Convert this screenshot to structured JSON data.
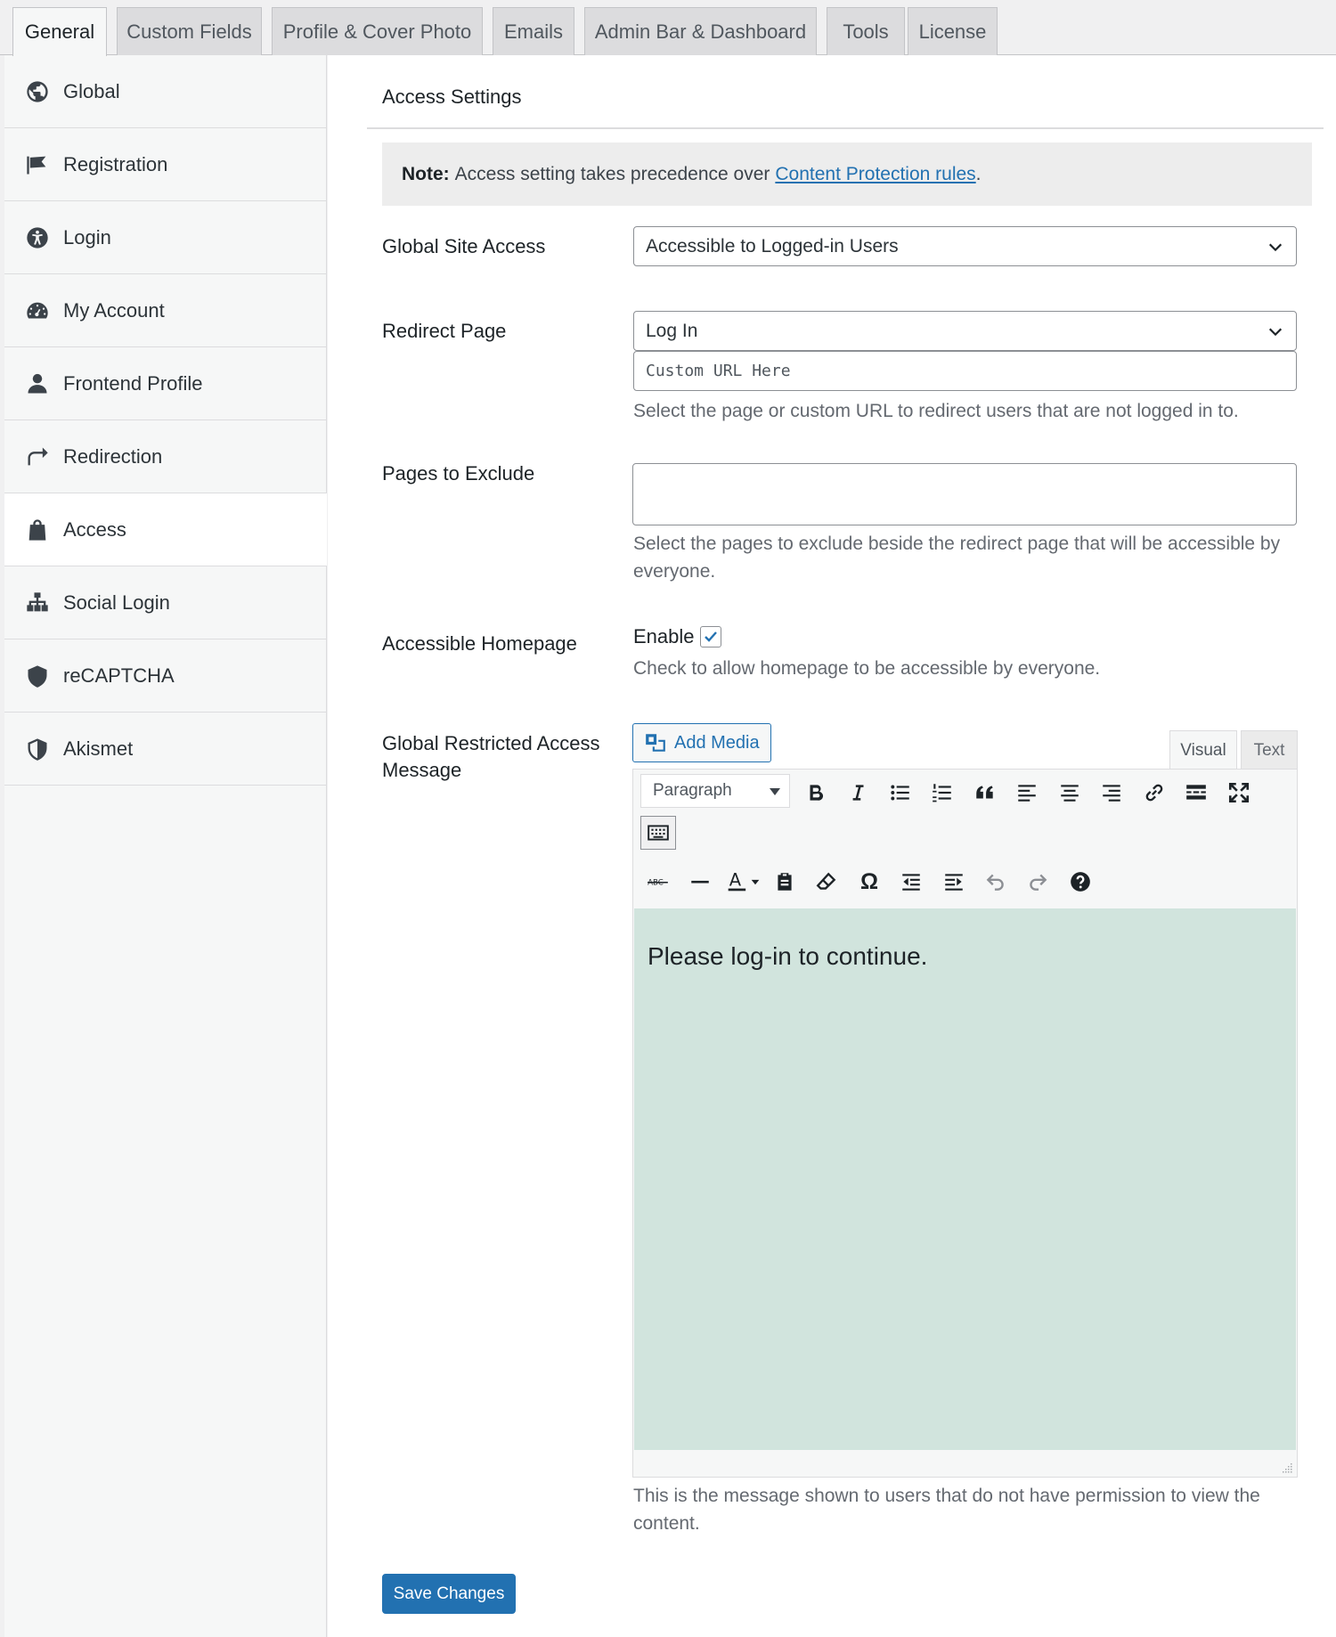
{
  "tabs": {
    "general": "General",
    "custom_fields": "Custom Fields",
    "profile_cover": "Profile & Cover Photo",
    "emails": "Emails",
    "admin_bar": "Admin Bar & Dashboard",
    "tools": "Tools",
    "license": "License"
  },
  "sidebar": {
    "global": "Global",
    "registration": "Registration",
    "login": "Login",
    "my_account": "My Account",
    "frontend_profile": "Frontend Profile",
    "redirection": "Redirection",
    "access": "Access",
    "social_login": "Social Login",
    "recaptcha": "reCAPTCHA",
    "akismet": "Akismet"
  },
  "main": {
    "section_title": "Access Settings",
    "note_label": "Note:",
    "note_text": "Access setting takes precedence over",
    "note_link": "Content Protection rules",
    "note_end": ".",
    "global_site_access": {
      "label": "Global Site Access",
      "value": "Accessible to Logged-in Users"
    },
    "redirect_page": {
      "label": "Redirect Page",
      "value": "Log In",
      "custom_url_placeholder": "Custom URL Here",
      "description": "Select the page or custom URL to redirect users that are not logged in to."
    },
    "pages_to_exclude": {
      "label": "Pages to Exclude",
      "description": "Select the pages to exclude beside the redirect page that will be accessible by everyone."
    },
    "accessible_homepage": {
      "label": "Accessible Homepage",
      "checkbox_label": "Enable",
      "checked": true,
      "description": "Check to allow homepage to be accessible by everyone."
    },
    "restricted_message": {
      "label": "Global Restricted Access Message",
      "add_media": "Add Media",
      "tab_visual": "Visual",
      "tab_text": "Text",
      "paragraph": "Paragraph",
      "content": "Please log-in to continue.",
      "description": "This is the message shown to users that do not have permission to view the content."
    },
    "save_button": "Save Changes"
  },
  "colors": {
    "accent": "#2271b1",
    "editor_bg": "#d1e4dd"
  }
}
